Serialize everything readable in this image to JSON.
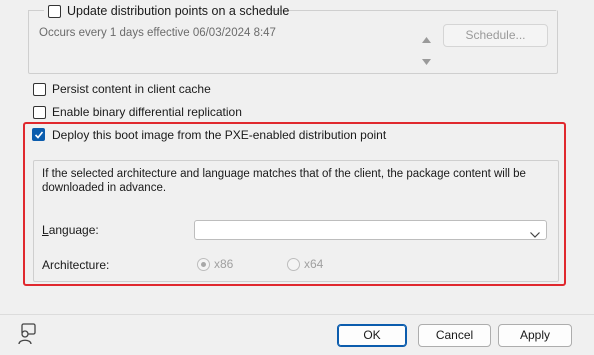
{
  "schedule": {
    "update_label": "Update distribution points on a schedule",
    "update_checked": false,
    "recurrence_text": "Occurs every 1 days effective 06/03/2024 8:47",
    "schedule_button": "Schedule..."
  },
  "options": {
    "persist_label": "Persist content in client cache",
    "persist_checked": false,
    "binary_label": "Enable binary differential replication",
    "binary_checked": false,
    "pxe_label": "Deploy this boot image from the PXE-enabled distribution point",
    "pxe_checked": true
  },
  "pxe_group": {
    "info_text_line1": "If the selected architecture and language matches that of the client, the package content will be",
    "info_text_line2": "downloaded in advance.",
    "language_label": "Language:",
    "language_value": "",
    "architecture_label": "Architecture:",
    "arch_options": [
      "x86",
      "x64"
    ],
    "arch_selected": "x86"
  },
  "footer": {
    "ok": "OK",
    "cancel": "Cancel",
    "apply": "Apply"
  },
  "colors": {
    "highlight_border": "#e0282e",
    "checkbox_checked": "#0b5cad"
  }
}
